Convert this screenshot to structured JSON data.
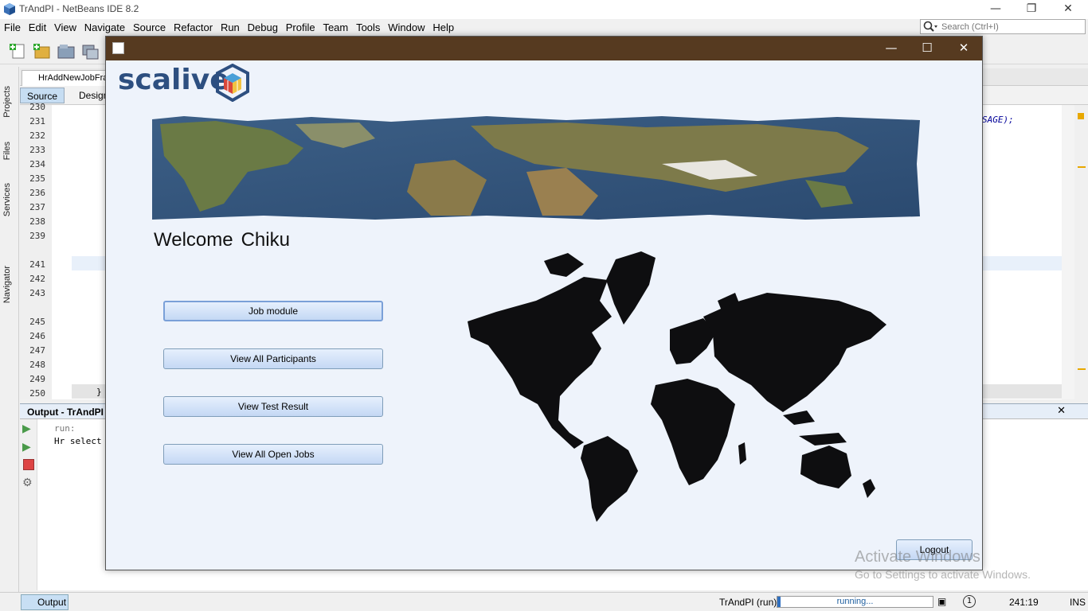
{
  "ide": {
    "window_title": "TrAndPI - NetBeans IDE 8.2",
    "menu": [
      "File",
      "Edit",
      "View",
      "Navigate",
      "Source",
      "Refactor",
      "Run",
      "Debug",
      "Profile",
      "Team",
      "Tools",
      "Window",
      "Help"
    ],
    "search_placeholder": "Search (Ctrl+I)",
    "side_tabs": [
      "Projects",
      "Files",
      "Services",
      "Navigator"
    ],
    "editor_tab": "HrAddNewJobFra",
    "subtabs": [
      "Source",
      "Design"
    ],
    "line_numbers": [
      "230",
      "231",
      "232",
      "233",
      "234",
      "235",
      "236",
      "237",
      "238",
      "239",
      "",
      "241",
      "242",
      "243",
      "",
      "245",
      "246",
      "247",
      "248",
      "249",
      "250"
    ],
    "code_fragment": "SAGE);",
    "code_brace": "}",
    "output_title": "Output - TrAndPI (",
    "output_lines": [
      "run:",
      "Hr select"
    ],
    "status": {
      "output_button": "Output",
      "project_run": "TrAndPI (run)",
      "progress_text": "running...",
      "progress_fraction": 0.02,
      "caret_position": "241:19",
      "insert_mode": "INS"
    }
  },
  "watermark": {
    "line1": "Activate Windows",
    "line2": "Go to Settings to activate Windows."
  },
  "app": {
    "logo_text": "scalive",
    "welcome_label": "Welcome",
    "user_name": "Chiku",
    "buttons": [
      "Job module",
      "View All Participants",
      "View Test Result",
      "View All Open Jobs"
    ],
    "logout_label": "Logout",
    "colors": {
      "titlebar": "#563a20",
      "background": "#eef3fb",
      "logo_blue": "#2d4f80",
      "button_top": "#e6f0fd",
      "button_bottom": "#c4d8f4"
    }
  }
}
